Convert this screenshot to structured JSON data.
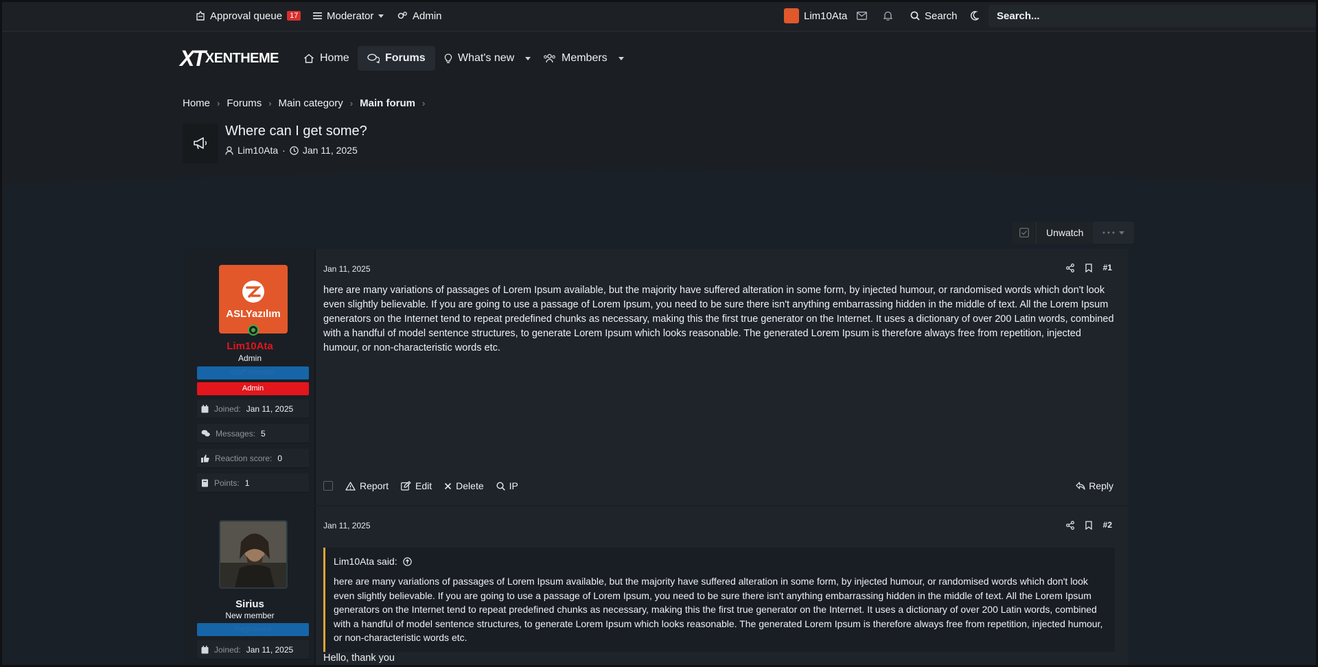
{
  "staffbar": {
    "approval_label": "Approval queue",
    "approval_count": "17",
    "moderator_label": "Moderator",
    "admin_label": "Admin",
    "user_label": "Lim10Ata",
    "search_label": "Search",
    "search_placeholder": "Search..."
  },
  "header": {
    "logo_mark": "XT",
    "logo_text": "XENTHEME",
    "nav": [
      {
        "label": "Home"
      },
      {
        "label": "Forums"
      },
      {
        "label": "What's new"
      },
      {
        "label": "Members"
      }
    ]
  },
  "breadcrumb": [
    "Home",
    "Forums",
    "Main category",
    "Main forum"
  ],
  "thread": {
    "title": "Where can I get some?",
    "author": "Lim10Ata",
    "date": "Jan 11, 2025",
    "meta_sep": "·"
  },
  "watch": {
    "label": "Unwatch"
  },
  "posts": [
    {
      "username": "Lim10Ata",
      "user_title": "Admin",
      "avatar_text": "ASLYazılım",
      "banners": [
        "Staff member",
        "Admin"
      ],
      "stats": [
        {
          "label": "Joined:",
          "value": "Jan 11, 2025"
        },
        {
          "label": "Messages:",
          "value": "5"
        },
        {
          "label": "Reaction score:",
          "value": "0"
        },
        {
          "label": "Points:",
          "value": "1"
        }
      ],
      "date": "Jan 11, 2025",
      "number": "#1",
      "body": "here are many variations of passages of Lorem Ipsum available, but the majority have suffered alteration in some form, by injected humour, or randomised words which don't look even slightly believable. If you are going to use a passage of Lorem Ipsum, you need to be sure there isn't anything embarrassing hidden in the middle of text. All the Lorem Ipsum generators on the Internet tend to repeat predefined chunks as necessary, making this the first true generator on the Internet. It uses a dictionary of over 200 Latin words, combined with a handful of model sentence structures, to generate Lorem Ipsum which looks reasonable. The generated Lorem Ipsum is therefore always free from repetition, injected humour, or non-characteristic words etc.",
      "actions": [
        "Report",
        "Edit",
        "Delete",
        "IP"
      ],
      "reply": "Reply"
    },
    {
      "username": "Sirius",
      "user_title": "New member",
      "banners": [
        "Registered"
      ],
      "stats": [
        {
          "label": "Joined:",
          "value": "Jan 11, 2025"
        }
      ],
      "date": "Jan 11, 2025",
      "number": "#2",
      "quote_author": "Lim10Ata said:",
      "quote_body": "here are many variations of passages of Lorem Ipsum available, but the majority have suffered alteration in some form, by injected humour, or randomised words which don't look even slightly believable. If you are going to use a passage of Lorem Ipsum, you need to be sure there isn't anything embarrassing hidden in the middle of text. All the Lorem Ipsum generators on the Internet tend to repeat predefined chunks as necessary, making this the first true generator on the Internet. It uses a dictionary of over 200 Latin words, combined with a handful of model sentence structures, to generate Lorem Ipsum which looks reasonable. The generated Lorem Ipsum is therefore always free from repetition, injected humour, or non-characteristic words etc.",
      "body": "Hello, thank you"
    }
  ],
  "colors": {
    "admin_red": "#e2161c",
    "staff_blue": "#1565a8",
    "quote_accent": "#e8a235",
    "count_badge": "#d92f2f"
  }
}
